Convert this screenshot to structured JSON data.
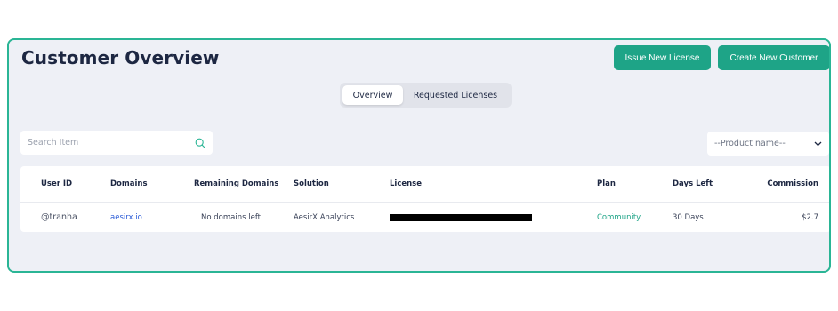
{
  "header": {
    "title": "Customer Overview",
    "issue_button": "Issue New License",
    "create_button": "Create New Customer"
  },
  "tabs": [
    {
      "label": "Overview",
      "active": true
    },
    {
      "label": "Requested Licenses",
      "active": false
    }
  ],
  "search": {
    "placeholder": "Search Item",
    "icon": "search-icon"
  },
  "product_filter": {
    "selected": "--Product name--",
    "icon": "chevron-down-icon"
  },
  "table": {
    "columns": [
      "User ID",
      "Domains",
      "Remaining Domains",
      "Solution",
      "License",
      "Plan",
      "Days Left",
      "Commission"
    ],
    "rows": [
      {
        "user_id": "@tranha",
        "domains": "aesirx.io",
        "remaining_domains": "No domains left",
        "solution": "AesirX Analytics",
        "license": "",
        "plan": "Community",
        "days_left": "30 Days",
        "commission": "$2.7"
      }
    ]
  },
  "colors": {
    "accent": "#1ea487",
    "border": "#2ab595",
    "panel_bg": "#eef0f6",
    "link": "#2a5bd7"
  }
}
